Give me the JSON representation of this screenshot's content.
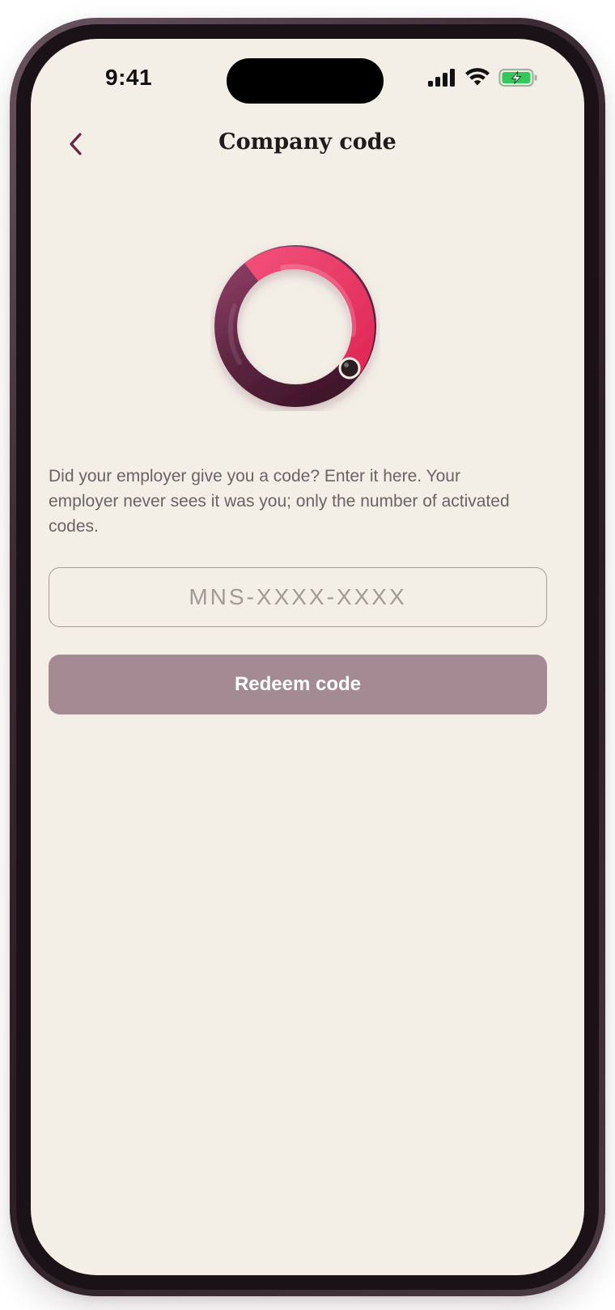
{
  "status_bar": {
    "time": "9:41",
    "icons": [
      "cellular-signal-icon",
      "wifi-icon",
      "battery-charging-icon"
    ],
    "battery_color": "#34c759"
  },
  "nav": {
    "back_icon": "chevron-left-icon",
    "title": "Company code"
  },
  "illustration": {
    "icon": "progress-ring-icon",
    "colors": {
      "pink": "#ee3b65",
      "plum": "#5a1f3c",
      "knob": "#2a1d20"
    }
  },
  "description": "Did your employer give you a code? Enter it here. Your employer never sees it was you; only the number of activated codes.",
  "code_input": {
    "value": "",
    "placeholder": "MNS-XXXX-XXXX"
  },
  "redeem_button": {
    "label": "Redeem code",
    "color": "#a48a92"
  },
  "colors": {
    "background": "#f3efe7",
    "accent": "#6a2440",
    "text": "#1f1a1c",
    "muted_text": "#6b6266"
  }
}
